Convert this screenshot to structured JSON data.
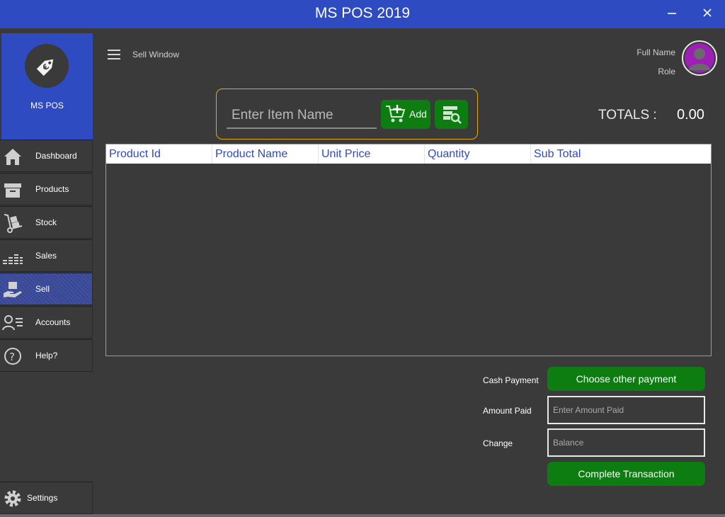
{
  "window": {
    "title": "MS POS 2019",
    "minimize": "—",
    "close": "✕"
  },
  "brand": {
    "name": "MS POS"
  },
  "nav": [
    {
      "label": "Dashboard"
    },
    {
      "label": "Products"
    },
    {
      "label": "Stock"
    },
    {
      "label": "Sales"
    },
    {
      "label": "Sell",
      "active": true
    },
    {
      "label": "Accounts"
    },
    {
      "label": "Help?"
    }
  ],
  "settings": {
    "label": "Settings"
  },
  "header": {
    "breadcrumb": "Sell Window",
    "full_name": "Full Name",
    "role": "Role"
  },
  "search": {
    "placeholder": "Enter Item Name",
    "add_label": "Add"
  },
  "totals": {
    "label": "TOTALS :",
    "value": "0.00"
  },
  "table": {
    "columns": [
      "Product Id",
      "Product Name",
      "Unit Price",
      "Quantity",
      "Sub Total"
    ],
    "rows": []
  },
  "payment": {
    "cash_label": "Cash Payment",
    "choose_other": "Choose other payment",
    "amount_label": "Amount Paid",
    "amount_placeholder": "Enter Amount Paid",
    "change_label": "Change",
    "change_placeholder": "Balance",
    "complete": "Complete Transaction"
  },
  "colors": {
    "titlebar": "#2f4bc1",
    "background": "#3a3a3a",
    "accent_green": "#0d7d12",
    "search_border": "#e6a817",
    "header_text": "#2f4bc1"
  }
}
